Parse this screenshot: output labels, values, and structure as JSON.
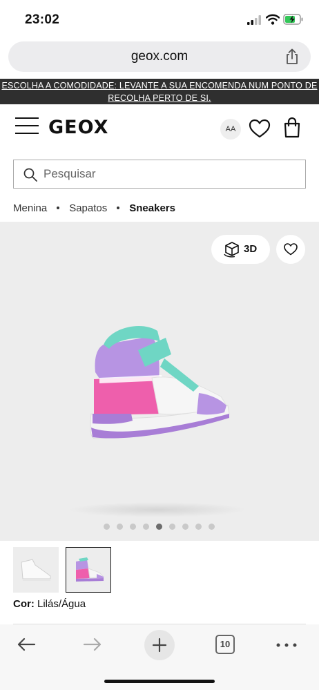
{
  "status_bar": {
    "time": "23:02"
  },
  "browser": {
    "url": "geox.com",
    "tabs_count": "10"
  },
  "banner": {
    "text": "ESCOLHA A COMODIDADE: LEVANTE A SUA ENCOMENDA NUM PONTO DE RECOLHA PERTO DE SI."
  },
  "header": {
    "logo": "GEOX",
    "font_size_button": "AA"
  },
  "search": {
    "placeholder": "Pesquisar"
  },
  "breadcrumb": {
    "items": [
      "Menina",
      "Sapatos",
      "Sneakers"
    ]
  },
  "gallery": {
    "view_3d_label": "3D",
    "dots_total": 9,
    "dots_active_index": 4
  },
  "product": {
    "color_label": "Cor:",
    "color_value": "Lilás/Água"
  },
  "colors": {
    "banner_bg": "#2f2f2f",
    "gallery_bg": "#ededed",
    "shoe_lilac": "#b48ce0",
    "shoe_pink": "#ee5fac",
    "shoe_aqua": "#6fd6c4"
  }
}
